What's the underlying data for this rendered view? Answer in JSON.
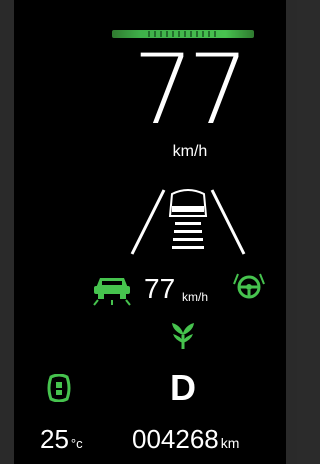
{
  "eco_indicator": {
    "color": "#46c34e"
  },
  "speed": {
    "value": "77",
    "unit": "km/h"
  },
  "lane_assist": {
    "icon": "lane-keeping-icon"
  },
  "cruise": {
    "set_speed": "77",
    "unit": "km/h",
    "left_icon": "adaptive-cruise-vehicle-icon",
    "right_icon": "steering-lane-assist-icon"
  },
  "eco_leaf_icon": "eco-leaf-icon",
  "seatbelt_icon": "tire-pressure-icon",
  "gear": "D",
  "temperature": {
    "value": "25",
    "unit": "°c"
  },
  "odometer": {
    "value": "004268",
    "unit": "km"
  },
  "colors": {
    "accent_green": "#46c34e",
    "text": "#ffffff",
    "background": "#000000"
  }
}
